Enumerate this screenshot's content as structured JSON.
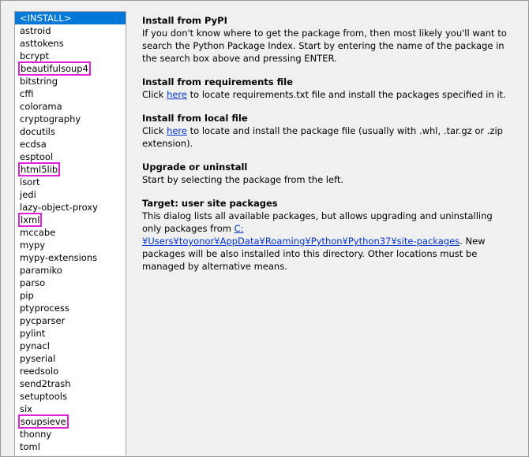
{
  "packages": {
    "items": [
      {
        "label": "<INSTALL>",
        "selected": true,
        "highlight": false
      },
      {
        "label": "astroid",
        "selected": false,
        "highlight": false
      },
      {
        "label": "asttokens",
        "selected": false,
        "highlight": false
      },
      {
        "label": "bcrypt",
        "selected": false,
        "highlight": false
      },
      {
        "label": "beautifulsoup4",
        "selected": false,
        "highlight": true
      },
      {
        "label": "bitstring",
        "selected": false,
        "highlight": false
      },
      {
        "label": "cffi",
        "selected": false,
        "highlight": false
      },
      {
        "label": "colorama",
        "selected": false,
        "highlight": false
      },
      {
        "label": "cryptography",
        "selected": false,
        "highlight": false
      },
      {
        "label": "docutils",
        "selected": false,
        "highlight": false
      },
      {
        "label": "ecdsa",
        "selected": false,
        "highlight": false
      },
      {
        "label": "esptool",
        "selected": false,
        "highlight": false
      },
      {
        "label": "html5lib",
        "selected": false,
        "highlight": true
      },
      {
        "label": "isort",
        "selected": false,
        "highlight": false
      },
      {
        "label": "jedi",
        "selected": false,
        "highlight": false
      },
      {
        "label": "lazy-object-proxy",
        "selected": false,
        "highlight": false
      },
      {
        "label": "lxml",
        "selected": false,
        "highlight": true
      },
      {
        "label": "mccabe",
        "selected": false,
        "highlight": false
      },
      {
        "label": "mypy",
        "selected": false,
        "highlight": false
      },
      {
        "label": "mypy-extensions",
        "selected": false,
        "highlight": false
      },
      {
        "label": "paramiko",
        "selected": false,
        "highlight": false
      },
      {
        "label": "parso",
        "selected": false,
        "highlight": false
      },
      {
        "label": "pip",
        "selected": false,
        "highlight": false
      },
      {
        "label": "ptyprocess",
        "selected": false,
        "highlight": false
      },
      {
        "label": "pycparser",
        "selected": false,
        "highlight": false
      },
      {
        "label": "pylint",
        "selected": false,
        "highlight": false
      },
      {
        "label": "pynacl",
        "selected": false,
        "highlight": false
      },
      {
        "label": "pyserial",
        "selected": false,
        "highlight": false
      },
      {
        "label": "reedsolo",
        "selected": false,
        "highlight": false
      },
      {
        "label": "send2trash",
        "selected": false,
        "highlight": false
      },
      {
        "label": "setuptools",
        "selected": false,
        "highlight": false
      },
      {
        "label": "six",
        "selected": false,
        "highlight": false
      },
      {
        "label": "soupsieve",
        "selected": false,
        "highlight": true
      },
      {
        "label": "thonny",
        "selected": false,
        "highlight": false
      },
      {
        "label": "toml",
        "selected": false,
        "highlight": false
      }
    ]
  },
  "colors": {
    "selected_bg": "#0078d7",
    "highlight_box": "#e020d8",
    "link": "#0033cc"
  },
  "info": {
    "pypi": {
      "title": "Install from PyPI",
      "text": "If you don't know where to get the package from, then most likely you'll want to search the Python Package Index. Start by entering the name of the package in the search box above and pressing ENTER."
    },
    "requirements": {
      "title": "Install from requirements file",
      "before": "Click ",
      "link": "here",
      "after": " to locate requirements.txt file and install the packages specified in it."
    },
    "local": {
      "title": "Install from local file",
      "before": "Click ",
      "link": "here",
      "after": " to locate and install the package file (usually with .whl, .tar.gz or .zip extension)."
    },
    "upgrade": {
      "title": "Upgrade or uninstall",
      "text": "Start by selecting the package from the left."
    },
    "target": {
      "title": "Target:  user site packages",
      "before": "This dialog lists all available packages, but allows upgrading and uninstalling only packages from ",
      "link": "C:¥Users¥toyonor¥AppData¥Roaming¥Python¥Python37¥site-packages",
      "after": ". New packages will be also installed into this directory. Other locations must be managed by alternative means."
    }
  }
}
